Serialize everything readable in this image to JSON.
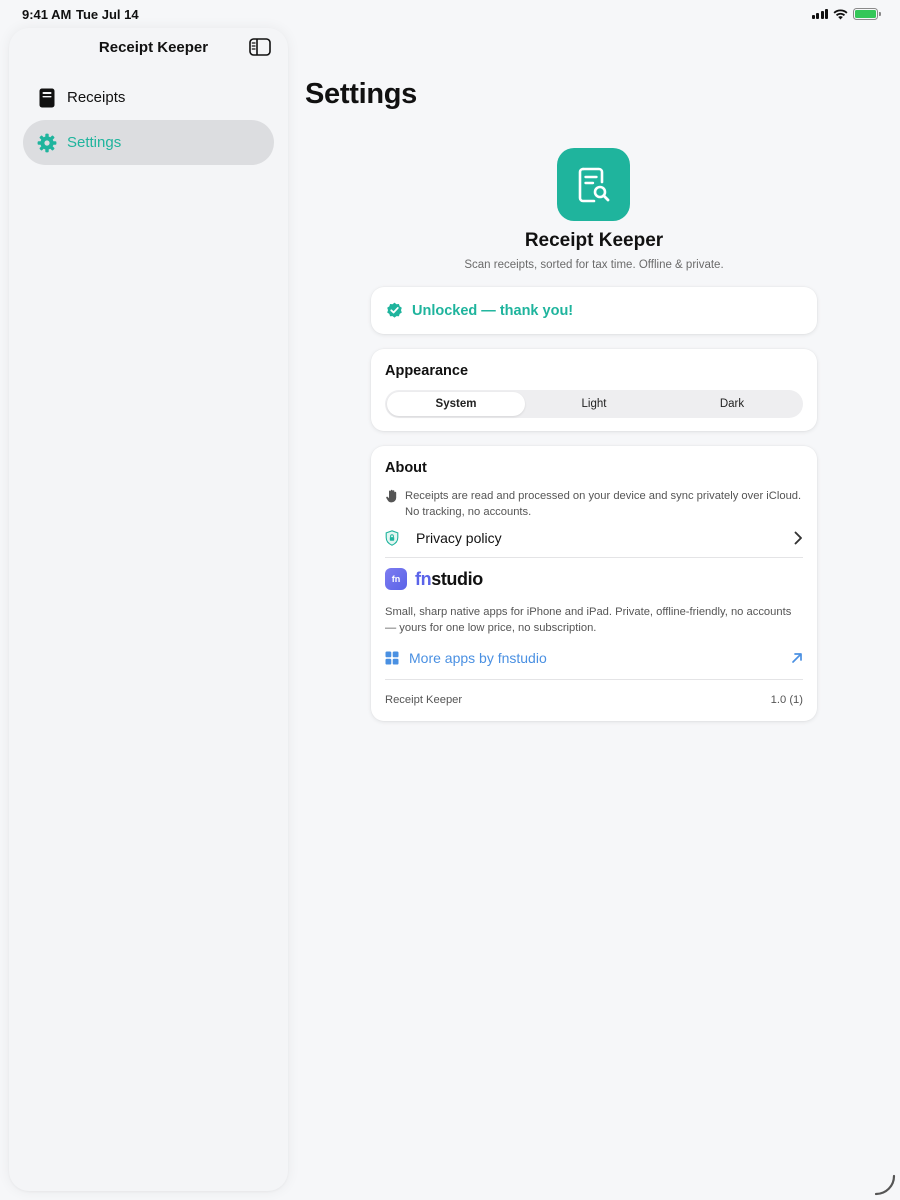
{
  "status_bar": {
    "time": "9:41 AM",
    "date": "Tue Jul 14",
    "battery_percent": 100
  },
  "sidebar": {
    "title": "Receipt Keeper",
    "toggle_icon": "sidebar-toggle-icon",
    "items": [
      {
        "label": "Receipts",
        "icon": "receipt-icon",
        "active": false
      },
      {
        "label": "Settings",
        "icon": "gear-icon",
        "active": true
      }
    ]
  },
  "main": {
    "title": "Settings",
    "app": {
      "name": "Receipt Keeper",
      "tagline": "Scan receipts, sorted for tax time. Offline & private.",
      "icon": "receipt-search-icon"
    },
    "unlocked": {
      "text": "Unlocked — thank you!",
      "icon": "checkmark-seal-icon"
    },
    "appearance": {
      "title": "Appearance",
      "options": [
        "System",
        "Light",
        "Dark"
      ],
      "selected": "System"
    },
    "about": {
      "title": "About",
      "description": "Receipts are read and processed on your device and sync privately over iCloud. No tracking, no accounts.",
      "privacy_label": "Privacy policy",
      "studio_badge": "fn",
      "studio_name_prefix": "fn",
      "studio_name_suffix": "studio",
      "studio_description": "Small, sharp native apps for iPhone and iPad. Private, offline-friendly, no accounts — yours for one low price, no subscription.",
      "more_apps_label": "More apps by fnstudio",
      "footer_app_name": "Receipt Keeper",
      "footer_version": "1.0 (1)"
    }
  },
  "colors": {
    "accent": "#1fb49d",
    "link": "#4a90e2",
    "studio": "#5b64e9",
    "background": "#f6f7f9"
  }
}
